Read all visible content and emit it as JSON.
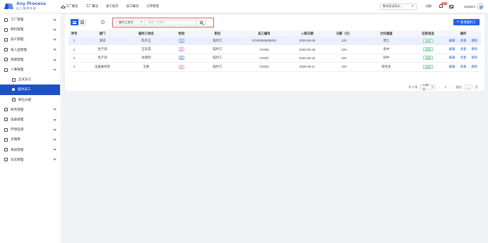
{
  "app": {
    "title": "Any Process",
    "subtitle": "加工管理系统"
  },
  "topnav": [
    {
      "label": "工厂概览"
    },
    {
      "label": "工厂概况"
    },
    {
      "label": "加工批次"
    },
    {
      "label": "加工概况"
    },
    {
      "label": "订单管理"
    }
  ],
  "header": {
    "site_select": "青岛阳记码头...",
    "switch_label": "切换",
    "notification_count": "99+",
    "username": "anyfarm"
  },
  "sidebar": {
    "items": [
      {
        "label": "工厂管理",
        "icon": "factory-icon",
        "expand": "down"
      },
      {
        "label": "原料管理",
        "icon": "box-icon",
        "expand": "down"
      },
      {
        "label": "加工管理",
        "icon": "tool-icon",
        "expand": "down"
      },
      {
        "label": "投入品管理",
        "icon": "supply-icon",
        "expand": "down"
      },
      {
        "label": "溯源管理",
        "icon": "trace-icon",
        "expand": "down"
      },
      {
        "label": "人事管理",
        "icon": "people-icon",
        "expand": "up"
      },
      {
        "label": "正式员工",
        "icon": "user-icon",
        "sub": true
      },
      {
        "label": "临时员工",
        "icon": "user-icon",
        "sub": true,
        "active": true
      },
      {
        "label": "职位分配",
        "icon": "group-icon",
        "sub": true
      },
      {
        "label": "财务管理",
        "icon": "finance-icon",
        "expand": "down"
      },
      {
        "label": "设备管理",
        "icon": "device-icon",
        "expand": "down"
      },
      {
        "label": "环境监测",
        "icon": "environment-icon",
        "expand": "down"
      },
      {
        "label": "云端库",
        "icon": "cloud-icon",
        "expand": "down"
      },
      {
        "label": "系统管理",
        "icon": "system-icon",
        "expand": "down"
      },
      {
        "label": "日志管理",
        "icon": "log-icon",
        "expand": "down"
      }
    ]
  },
  "toolbar": {
    "search_field": "临时工姓名",
    "search_placeholder": "请输入关键词",
    "add_button": "新增临时工"
  },
  "table": {
    "headers": [
      "序号",
      "部门",
      "临时工姓名",
      "性别",
      "职位",
      "员工编号",
      "入职日期",
      "日薪（元）",
      "文化程度",
      "在职状态",
      "操作"
    ],
    "rows": [
      {
        "idx": "1",
        "dept": "测试",
        "name": "陈齐正",
        "gender": "男",
        "gender_type": "male",
        "position": "临时工",
        "no": "YG200828090001",
        "date": "2025-08-28",
        "wage": "120",
        "edu": "博士",
        "status": "在职",
        "selected": true
      },
      {
        "idx": "2",
        "dept": "生产部",
        "name": "王彩霞",
        "gender": "女",
        "gender_type": "female",
        "position": "临时工",
        "no": "YG056",
        "date": "2024-08-28",
        "wage": "100",
        "edu": "高中",
        "status": "在职"
      },
      {
        "idx": "3",
        "dept": "生产部",
        "name": "张建明",
        "gender": "男",
        "gender_type": "male",
        "position": "临时工",
        "no": "YG057",
        "date": "2024-08-19",
        "wage": "220",
        "edu": "初中",
        "status": "在职"
      },
      {
        "idx": "4",
        "dept": "设备维修部",
        "name": "王敏",
        "gender": "女",
        "gender_type": "female",
        "position": "临时工",
        "no": "YG054",
        "date": "2025-08-11",
        "wage": "150",
        "edu": "研究生",
        "status": "在职"
      }
    ],
    "op_edit": "编辑",
    "op_view": "查看",
    "op_delete": "删除"
  },
  "pagination": {
    "total": "共 4 条",
    "page_size": "10条/页",
    "current": "1",
    "goto_label": "前往",
    "goto_value": "1",
    "page_unit": "页"
  }
}
